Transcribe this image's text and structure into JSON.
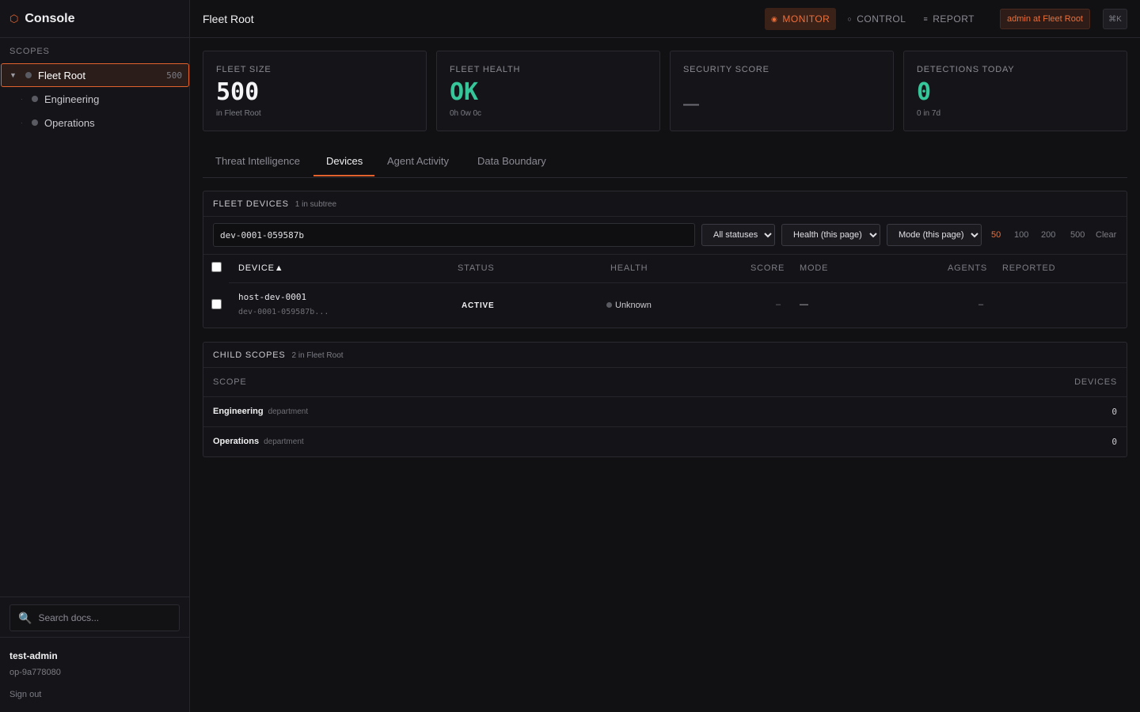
{
  "brand": {
    "icon": "hexagon-icon",
    "title": "Console"
  },
  "sidebar": {
    "section_label": "SCOPES",
    "tree": [
      {
        "label": "Fleet Root",
        "count": "500",
        "toggle": "▼",
        "active": true
      },
      {
        "label": "Engineering",
        "toggle": "·"
      },
      {
        "label": "Operations",
        "toggle": "·"
      }
    ],
    "search_placeholder": "Search docs...",
    "user_name": "test-admin",
    "user_id": "op-9a778080",
    "sign_out": "Sign out"
  },
  "header": {
    "title": "Fleet Root",
    "modes": [
      {
        "glyph": "◉",
        "label": "MONITOR",
        "active": true
      },
      {
        "glyph": "○",
        "label": "CONTROL"
      },
      {
        "glyph": "≡",
        "label": "REPORT"
      }
    ],
    "scope_pill": "admin at Fleet Root",
    "shortcut": "⌘K"
  },
  "stats": [
    {
      "label": "FLEET SIZE",
      "value": "500",
      "sub": "in Fleet Root"
    },
    {
      "label": "FLEET HEALTH",
      "value": "OK",
      "sub": "0h 0w 0c"
    },
    {
      "label": "SECURITY SCORE",
      "value": "—",
      "sub": ""
    },
    {
      "label": "DETECTIONS TODAY",
      "value": "0",
      "sub": "0 in 7d"
    }
  ],
  "tabs": [
    "Threat Intelligence",
    "Devices",
    "Agent Activity",
    "Data Boundary"
  ],
  "active_tab": "Devices",
  "devices_panel": {
    "title": "FLEET DEVICES",
    "meta": "1 in subtree",
    "filter_value": "dev-0001-059587b",
    "status_select": "All statuses",
    "health_select": "Health (this page)",
    "mode_select": "Mode (this page)",
    "page_sizes": [
      "50",
      "100",
      "200",
      "500"
    ],
    "clear": "Clear",
    "columns": [
      "DEVICE▲",
      "STATUS",
      "HEALTH",
      "SCORE",
      "MODE",
      "AGENTS",
      "REPORTED"
    ],
    "rows": [
      {
        "name": "host-dev-0001",
        "id": "dev-0001-059587b...",
        "status": "ACTIVE",
        "health": "Unknown",
        "score": "–",
        "mode": "—",
        "agents": "–",
        "reported": ""
      }
    ]
  },
  "scopes_panel": {
    "title": "CHILD SCOPES",
    "meta": "2 in Fleet Root",
    "col_scope": "SCOPE",
    "col_devices": "DEVICES",
    "rows": [
      {
        "name": "Engineering",
        "type": "department",
        "devices": "0"
      },
      {
        "name": "Operations",
        "type": "department",
        "devices": "0"
      }
    ]
  },
  "colors": {
    "accent": "#e2622e",
    "ok": "#35c79a",
    "bg": "#111114"
  }
}
